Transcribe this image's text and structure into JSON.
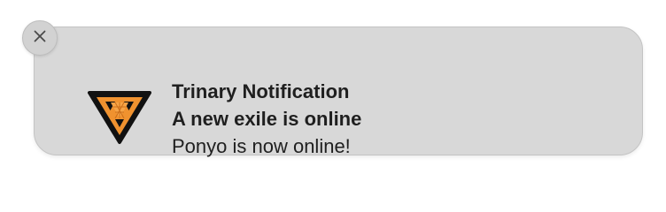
{
  "notification": {
    "app_name": "Trinary Notification",
    "title": "A new exile is online",
    "body": "Ponyo is now online!",
    "app_icon": "trinary-emblem-icon",
    "close_icon": "close-icon"
  },
  "colors": {
    "background": "#d8d8d8",
    "icon_orange": "#f0922f",
    "icon_outline": "#111111",
    "text": "#1f1f1f"
  }
}
